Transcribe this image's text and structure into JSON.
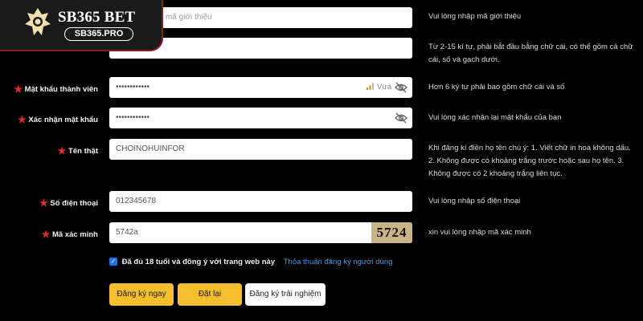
{
  "logo": {
    "brand": "SB365 BET",
    "domain": "SB365.PRO"
  },
  "rows": [
    {
      "id": "referral",
      "label": "",
      "value": "",
      "placeholder": "mã giới thiệu",
      "hint": "Vui lòng nhập mã giới thiệu"
    },
    {
      "id": "username",
      "label": "",
      "value": "",
      "placeholder": "",
      "hint": "Từ 2-15 kí tự, phải bắt đầu bằng chữ cái, có thể gồm cả chữ cái, số và gạch dưới."
    },
    {
      "id": "password",
      "label": "Mật khẩu thành viên",
      "value": "••••••••••••",
      "strength": "Vừa",
      "hint": "Hơn 6 ký tự phải bao gồm chữ cái và số"
    },
    {
      "id": "confirm",
      "label": "Xác nhận mật khẩu",
      "value": "••••••••••••",
      "hint": "Vui lòng xác nhận lại mật khẩu của bạn"
    },
    {
      "id": "realname",
      "label": "Tên thật",
      "value": "CHOINOHUINFOR",
      "hint": "Khi đăng kí điền họ tên chú ý: 1. Viết chữ in hoa không dấu. 2. Không được có khoảng trắng trước hoặc sau họ tên. 3. Không được có 2 khoảng trắng liên tục."
    },
    {
      "id": "phone",
      "label": "Số điện thoại",
      "value": "012345678",
      "hint": "Vui lòng nhập số điện thoại"
    },
    {
      "id": "captcha",
      "label": "Mã xác minh",
      "value": "5742a",
      "captcha_code": "5724",
      "hint": "xin vui lòng nhập mã xác minh"
    }
  ],
  "agreement": {
    "checked": true,
    "text": "Đã đủ 18 tuổi và đồng ý với trang web này",
    "link": "Thỏa thuận đăng ký người dùng"
  },
  "buttons": {
    "register": "Đăng ký ngay",
    "reset": "Đặt lại",
    "trial": "Đăng ký trải nghiệm"
  },
  "colors": {
    "accent": "#f5be2c",
    "required_star": "#e32b2b",
    "link": "#4c9be8",
    "background": "#000000"
  }
}
